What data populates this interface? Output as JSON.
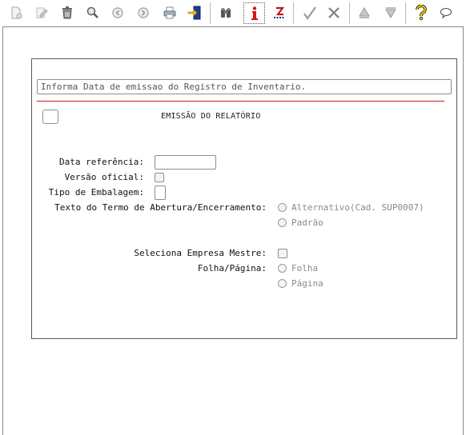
{
  "toolbar": {
    "buttons": [
      {
        "icon": "new-document-icon"
      },
      {
        "icon": "edit-pencil-icon"
      },
      {
        "icon": "trash-icon"
      },
      {
        "icon": "search-magnifier-icon"
      },
      {
        "icon": "previous-record-icon"
      },
      {
        "icon": "next-record-icon"
      },
      {
        "icon": "print-icon"
      },
      {
        "icon": "exit-door-icon"
      },
      {
        "icon": "binoculars-icon"
      },
      {
        "icon": "info-icon"
      },
      {
        "icon": "z-sort-icon"
      },
      {
        "icon": "confirm-check-icon"
      },
      {
        "icon": "cancel-icon"
      },
      {
        "icon": "move-up-icon"
      },
      {
        "icon": "move-down-icon"
      },
      {
        "icon": "help-question-icon"
      },
      {
        "icon": "comment-balloon-icon"
      }
    ]
  },
  "form": {
    "info_text": "Informa Data de emissao do Registro de Inventario.",
    "section_title": "EMISSÃO DO RELATÓRIO",
    "labels": {
      "data_referencia": "Data referência:",
      "versao_oficial": "Versão oficial:",
      "tipo_embalagem": "Tipo de Embalagem:",
      "texto_termo": "Texto do Termo de Abertura/Encerramento:",
      "seleciona_empresa": "Seleciona Empresa Mestre:",
      "folha_pagina": "Folha/Página:"
    },
    "values": {
      "data_referencia": "",
      "tipo_embalagem": ""
    },
    "radio_termo": [
      "Alternativo(Cad. SUP0007)",
      "Padrão"
    ],
    "radio_folha": [
      "Folha",
      "Página"
    ]
  }
}
